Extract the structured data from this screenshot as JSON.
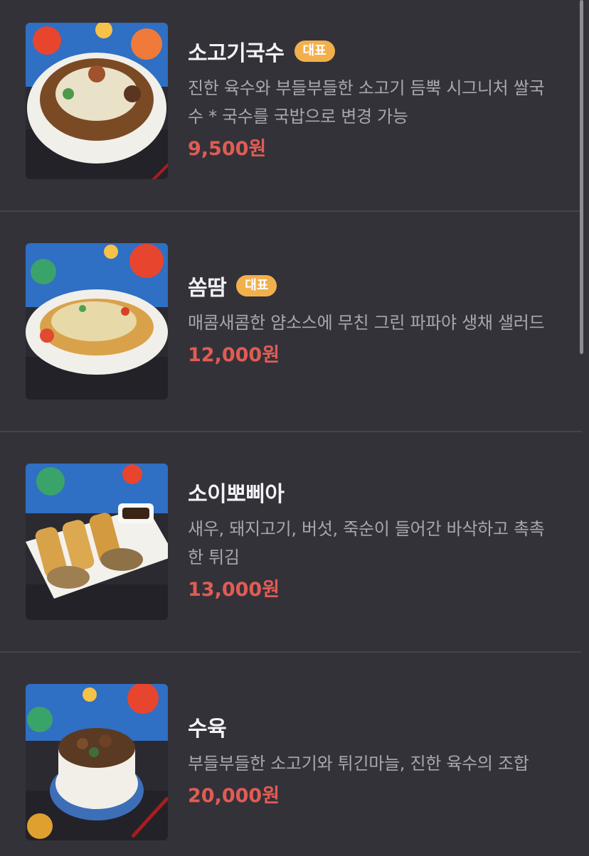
{
  "menu": {
    "items": [
      {
        "name": "소고기국수",
        "badge": "대표",
        "description": "진한 육수와 부들부들한 소고기 듬뿍 시그니처 쌀국수 * 국수를 국밥으로 변경 가능",
        "price": "9,500원",
        "image": "beef-noodle-soup-photo"
      },
      {
        "name": "쏨땀",
        "badge": "대표",
        "description": "매콤새콤한 얌소스에 무친 그린 파파야 생채 샐러드",
        "price": "12,000원",
        "image": "papaya-salad-photo"
      },
      {
        "name": "소이뽀삐아",
        "badge": "",
        "description": "새우, 돼지고기, 버섯, 죽순이 들어간 바삭하고 촉촉한 튀김",
        "price": "13,000원",
        "image": "spring-rolls-photo"
      },
      {
        "name": "수육",
        "badge": "",
        "description": "부들부들한 소고기와 튀긴마늘, 진한 육수의 조합",
        "price": "20,000원",
        "image": "braised-beef-photo"
      }
    ]
  },
  "colors": {
    "background": "#343239",
    "badge": "#f2b04c",
    "price": "#e05c55",
    "title": "#f3f2f5",
    "description": "#a9a7ae"
  }
}
